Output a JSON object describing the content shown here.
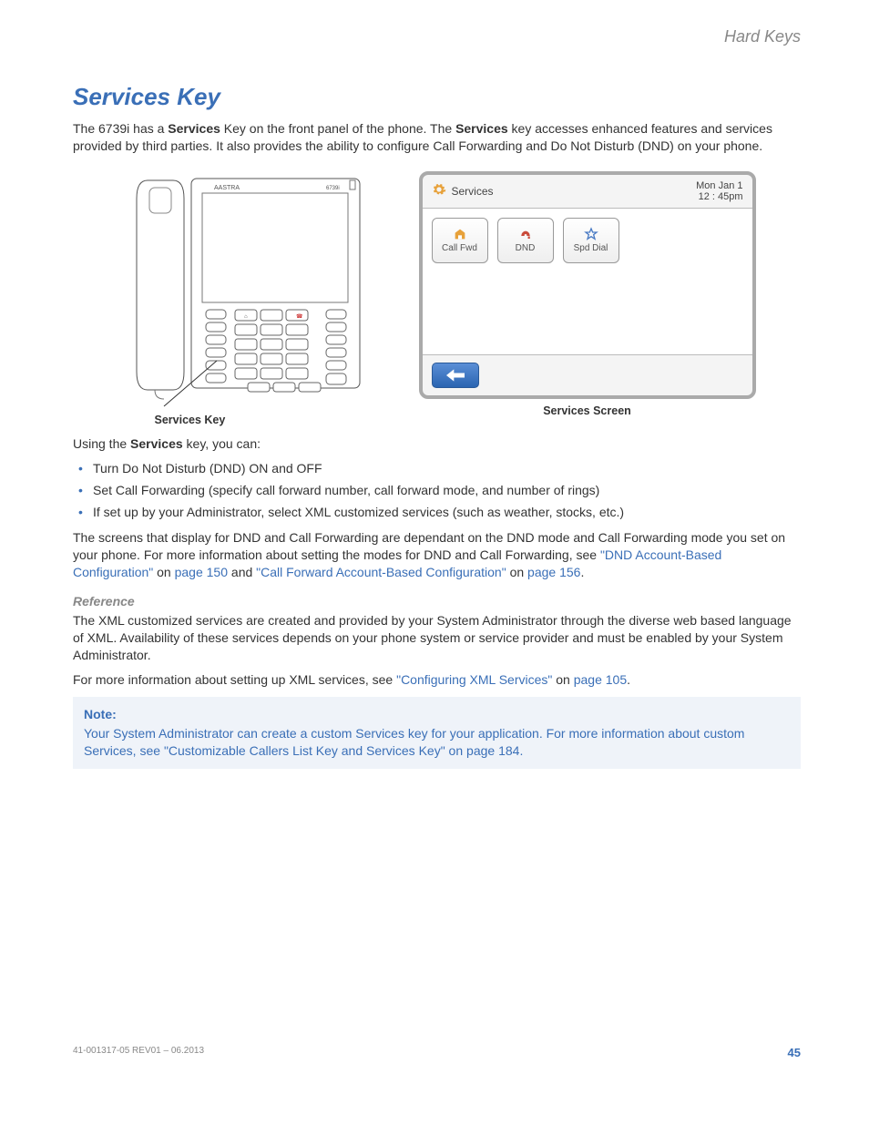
{
  "running_head": "Hard Keys",
  "section_title": "Services Key",
  "intro": {
    "p1a": "The 6739i has a ",
    "p1b": "Services",
    "p1c": " Key on the front panel of the phone. The ",
    "p1d": "Services",
    "p1e": " key accesses enhanced features and services provided by third parties. It also provides the ability to configure Call Forwarding and Do Not Disturb (DND) on your phone."
  },
  "phone_caption": "Services Key",
  "screen_caption": "Services Screen",
  "screen": {
    "title": "Services",
    "date": "Mon Jan 1",
    "time": "12 : 45pm",
    "buttons": [
      {
        "label": "Call Fwd"
      },
      {
        "label": "DND"
      },
      {
        "label": "Spd Dial"
      }
    ]
  },
  "using_intro_a": "Using the ",
  "using_intro_b": "Services",
  "using_intro_c": " key, you can:",
  "bullets": [
    "Turn Do Not Disturb (DND) ON and OFF",
    "Set Call Forwarding (specify call forward number, call forward mode, and number of rings)",
    "If set up by your Administrator, select XML customized services (such as weather, stocks, etc.)"
  ],
  "after_bullets": {
    "a": "The screens that display for DND and Call Forwarding are dependant on the DND mode and Call Forwarding mode you set on your phone. For more information about setting the modes for DND and Call Forwarding, see ",
    "link1": "\"DND Account-Based Configuration\"",
    "b": " on ",
    "page1": "page 150",
    "c": " and ",
    "link2": "\"Call Forward Account-Based Configuration\"",
    "d": " on ",
    "page2": "page 156",
    "e": "."
  },
  "reference_head": "Reference",
  "reference_p1": "The XML customized services are created and provided by your System Administrator through the diverse web based language of XML. Availability of these services depends on your phone system or service provider and must be enabled by your System Administrator.",
  "reference_p2a": "For more information about setting up XML services, see ",
  "reference_link": "\"Configuring XML Services\"",
  "reference_p2b": " on ",
  "reference_page": "page 105",
  "reference_p2c": ".",
  "note": {
    "label": "Note:",
    "a": "Your System Administrator can create a custom Services key for your application. For more information about custom Services, see ",
    "link": "\"Customizable Callers List Key and Services Key\"",
    "b": " on ",
    "page": "page 184",
    "c": "."
  },
  "footer_doc": "41-001317-05 REV01 – 06.2013",
  "footer_page": "45"
}
